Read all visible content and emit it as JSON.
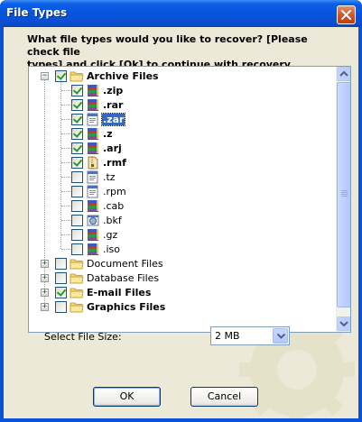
{
  "window": {
    "title": "File Types"
  },
  "question": {
    "line1": "What file types would you like to recover? [Please check file",
    "line2": "types] and click [Ok] to continue with recovery."
  },
  "tree": {
    "items": [
      {
        "label": "Archive Files",
        "level": 0,
        "checked": true,
        "bold": true,
        "selected": false,
        "expander": "−",
        "icon": "folder-icon"
      },
      {
        "label": ".zip",
        "level": 1,
        "checked": true,
        "bold": true,
        "selected": false,
        "icon": "archive-books-icon"
      },
      {
        "label": ".rar",
        "level": 1,
        "checked": true,
        "bold": true,
        "selected": false,
        "icon": "archive-books-icon"
      },
      {
        "label": ".zar",
        "level": 1,
        "checked": true,
        "bold": true,
        "selected": true,
        "icon": "document-window-icon"
      },
      {
        "label": ".z",
        "level": 1,
        "checked": true,
        "bold": true,
        "selected": false,
        "icon": "archive-books-icon"
      },
      {
        "label": ".arj",
        "level": 1,
        "checked": true,
        "bold": true,
        "selected": false,
        "icon": "archive-books-icon"
      },
      {
        "label": ".rmf",
        "level": 1,
        "checked": true,
        "bold": true,
        "selected": false,
        "icon": "zipper-file-icon"
      },
      {
        "label": ".tz",
        "level": 1,
        "checked": false,
        "bold": false,
        "selected": false,
        "icon": "document-window-icon"
      },
      {
        "label": ".rpm",
        "level": 1,
        "checked": false,
        "bold": false,
        "selected": false,
        "icon": "document-window-icon"
      },
      {
        "label": ".cab",
        "level": 1,
        "checked": false,
        "bold": false,
        "selected": false,
        "icon": "archive-books-icon"
      },
      {
        "label": ".bkf",
        "level": 1,
        "checked": false,
        "bold": false,
        "selected": false,
        "icon": "backup-file-icon"
      },
      {
        "label": ".gz",
        "level": 1,
        "checked": false,
        "bold": false,
        "selected": false,
        "icon": "archive-books-icon"
      },
      {
        "label": ".iso",
        "level": 1,
        "checked": false,
        "bold": false,
        "selected": false,
        "icon": "archive-books-icon"
      },
      {
        "label": "Document Files",
        "level": 0,
        "checked": false,
        "bold": false,
        "selected": false,
        "expander": "+",
        "icon": "folder-icon"
      },
      {
        "label": "Database Files",
        "level": 0,
        "checked": false,
        "bold": false,
        "selected": false,
        "expander": "+",
        "icon": "folder-icon"
      },
      {
        "label": "E-mail Files",
        "level": 0,
        "checked": true,
        "bold": true,
        "selected": false,
        "expander": "+",
        "icon": "folder-icon"
      },
      {
        "label": "Graphics Files",
        "level": 0,
        "checked": false,
        "bold": true,
        "selected": false,
        "expander": "+",
        "icon": "folder-icon"
      }
    ]
  },
  "file_size": {
    "label": "Select File Size:",
    "selected": "2 MB"
  },
  "buttons": {
    "ok": "OK",
    "cancel": "Cancel"
  },
  "colors": {
    "title_bar": "#0654dc",
    "dialog_face": "#ece9d8",
    "selection": "#316ac5",
    "close_button": "#d1541f"
  }
}
